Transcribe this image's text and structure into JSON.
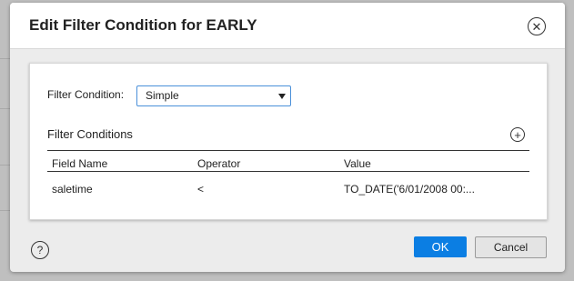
{
  "dialog": {
    "title": "Edit Filter Condition for EARLY",
    "close_icon": "close-icon"
  },
  "filter": {
    "condition_label": "Filter Condition:",
    "condition_value": "Simple",
    "dropdown_icon": "triangle-down-icon"
  },
  "conditions": {
    "title": "Filter Conditions",
    "add_icon": "plus-circle-icon",
    "columns": [
      "Field Name",
      "Operator",
      "Value"
    ],
    "rows": [
      {
        "field": "saletime",
        "operator": "<",
        "value": "TO_DATE('6/01/2008 00:..."
      }
    ]
  },
  "footer": {
    "help_icon": "help-icon",
    "ok_label": "OK",
    "cancel_label": "Cancel"
  },
  "colors": {
    "primary": "#0b7ee3",
    "focus_border": "#4a90d9",
    "background": "#bfbfbf"
  }
}
